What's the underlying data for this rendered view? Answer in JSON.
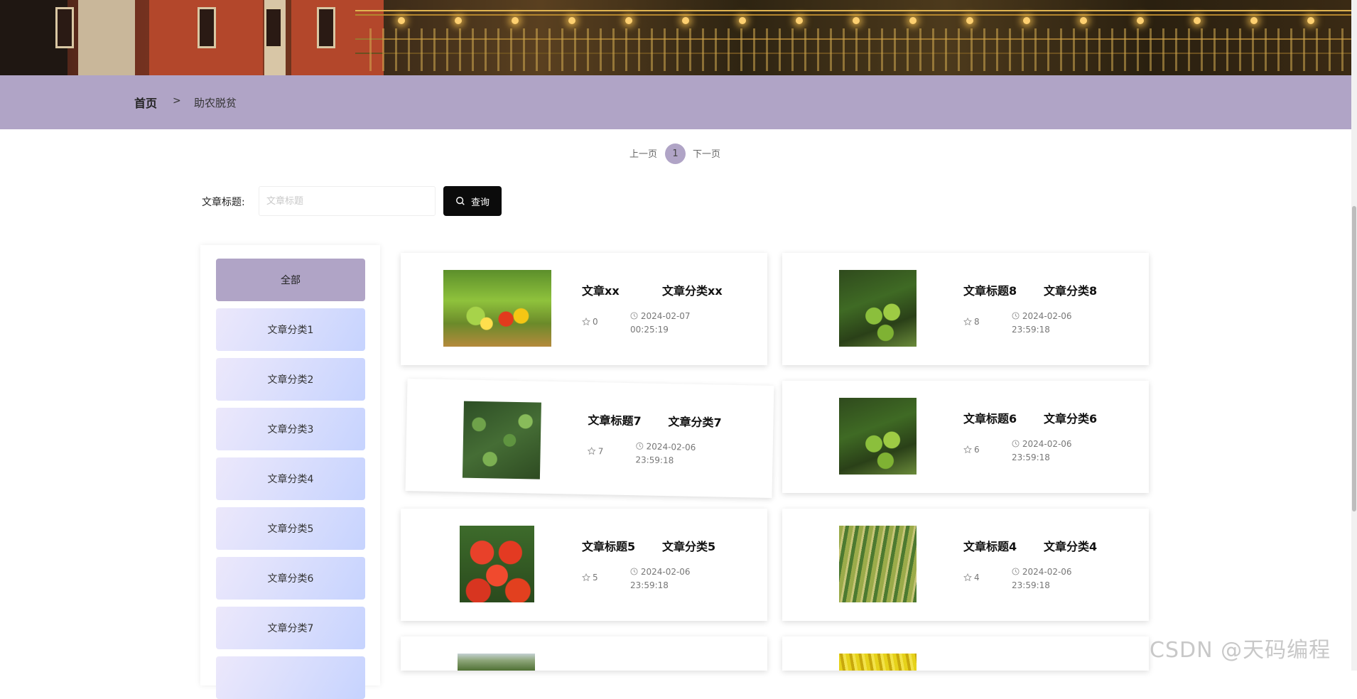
{
  "breadcrumb": {
    "home": "首页",
    "separator": ">",
    "current": "助农脱贫"
  },
  "pagination": {
    "prev": "上一页",
    "current_page": "1",
    "next": "下一页"
  },
  "search": {
    "label": "文章标题:",
    "placeholder": "文章标题",
    "value": "",
    "button_label": "查询",
    "button_icon": "search-icon"
  },
  "sidebar": {
    "items": [
      {
        "label": "全部",
        "active": true
      },
      {
        "label": "文章分类1"
      },
      {
        "label": "文章分类2"
      },
      {
        "label": "文章分类3"
      },
      {
        "label": "文章分类4"
      },
      {
        "label": "文章分类5"
      },
      {
        "label": "文章分类6"
      },
      {
        "label": "文章分类7"
      }
    ]
  },
  "articles": [
    {
      "title": "文章xx",
      "category": "文章分类xx",
      "likes": "0",
      "date": "2024-02-07",
      "time": "00:25:19",
      "image": "vegetable-basket"
    },
    {
      "title": "文章标题8",
      "category": "文章分类8",
      "likes": "8",
      "date": "2024-02-06",
      "time": "23:59:18",
      "image": "green-tomatoes"
    },
    {
      "title": "文章标题7",
      "category": "文章分类7",
      "likes": "7",
      "date": "2024-02-06",
      "time": "23:59:18",
      "image": "leafy-field"
    },
    {
      "title": "文章标题6",
      "category": "文章分类6",
      "likes": "6",
      "date": "2024-02-06",
      "time": "23:59:18",
      "image": "green-tomatoes"
    },
    {
      "title": "文章标题5",
      "category": "文章分类5",
      "likes": "5",
      "date": "2024-02-06",
      "time": "23:59:18",
      "image": "red-tomatoes"
    },
    {
      "title": "文章标题4",
      "category": "文章分类4",
      "likes": "4",
      "date": "2024-02-06",
      "time": "23:59:18",
      "image": "millet"
    }
  ],
  "watermark": "CSDN @天码编程",
  "colors": {
    "accent": "#b0a4c6",
    "button": "#0b0b0b",
    "category_gradient_start": "#ece8fb",
    "category_gradient_end": "#c6d3fe"
  }
}
